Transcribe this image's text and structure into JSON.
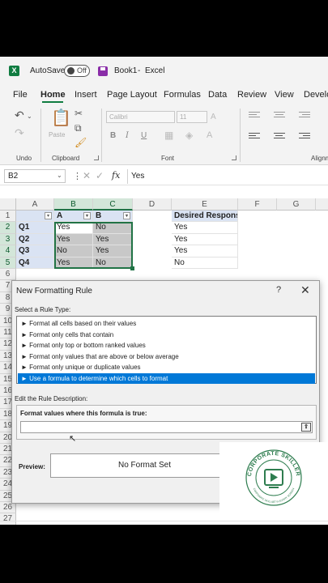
{
  "titlebar": {
    "app_icon": "X",
    "autosave_label": "AutoSave",
    "autosave_state": "Off",
    "document": "Book1",
    "separator": "-",
    "app": "Excel"
  },
  "ribbon": {
    "tabs": [
      "File",
      "Home",
      "Insert",
      "Page Layout",
      "Formulas",
      "Data",
      "Review",
      "View",
      "Develo"
    ],
    "active_tab": "Home",
    "groups": {
      "undo": "Undo",
      "clipboard": "Clipboard",
      "font": "Font",
      "alignment": "Alignm"
    },
    "paste_label": "Paste",
    "font_name": "Calibri",
    "font_size": "11",
    "bold": "B",
    "italic": "I",
    "underline": "U"
  },
  "formula_bar": {
    "name_box": "B2",
    "fx": "fx",
    "value": "Yes"
  },
  "grid": {
    "columns": [
      "A",
      "B",
      "C",
      "D",
      "E",
      "F",
      "G"
    ],
    "rows": [
      "1",
      "2",
      "3",
      "4",
      "5",
      "6",
      "7",
      "8",
      "9",
      "10",
      "11",
      "12",
      "13",
      "14",
      "15",
      "16",
      "17",
      "18",
      "19",
      "20",
      "21",
      "22",
      "23",
      "24",
      "25",
      "26",
      "27"
    ],
    "header_row": {
      "b": "A",
      "c": "B",
      "e": "Desired Response"
    },
    "data": [
      {
        "q": "Q1",
        "b": "Yes",
        "c": "No",
        "e": "Yes"
      },
      {
        "q": "Q2",
        "b": "Yes",
        "c": "Yes",
        "e": "Yes"
      },
      {
        "q": "Q3",
        "b": "No",
        "c": "Yes",
        "e": "Yes"
      },
      {
        "q": "Q4",
        "b": "Yes",
        "c": "No",
        "e": "No"
      }
    ]
  },
  "dialog": {
    "title": "New Formatting Rule",
    "help": "?",
    "close": "✕",
    "select_label": "Select a Rule Type:",
    "rules": [
      "► Format all cells based on their values",
      "► Format only cells that contain",
      "► Format only top or bottom ranked values",
      "► Format only values that are above or below average",
      "► Format only unique or duplicate values",
      "► Use a formula to determine which cells to format"
    ],
    "selected_rule_index": 5,
    "edit_label": "Edit the Rule Description:",
    "formula_label": "Format values where this formula is true:",
    "formula_value": "",
    "preview_label": "Preview:",
    "preview_text": "No Format Set"
  },
  "watermark": {
    "text": "CORPORATE SKILLER",
    "subtext": "CORPORATE SKILLSET IN EVERY SCREEN",
    "color": "#2e7d4f"
  },
  "colors": {
    "excel_green": "#217346",
    "selection_blue": "#0078d7",
    "q_fill": "#dae3f3"
  }
}
